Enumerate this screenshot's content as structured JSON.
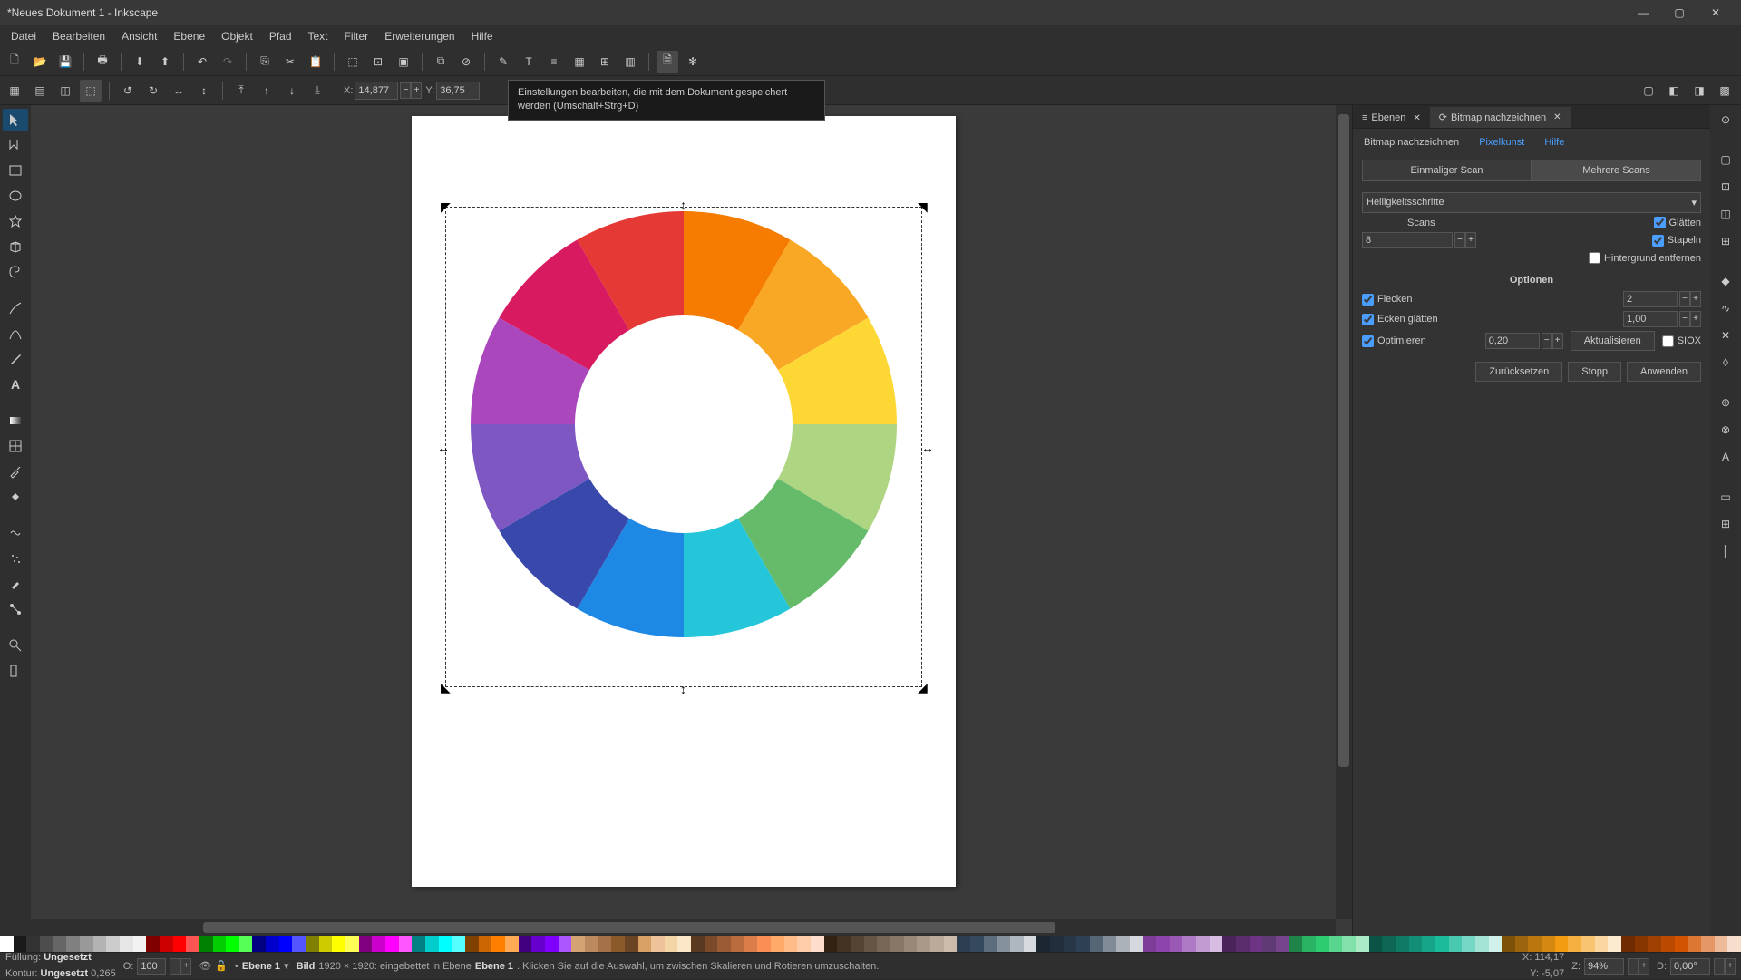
{
  "title": "*Neues Dokument 1 - Inkscape",
  "menu": [
    "Datei",
    "Bearbeiten",
    "Ansicht",
    "Ebene",
    "Objekt",
    "Pfad",
    "Text",
    "Filter",
    "Erweiterungen",
    "Hilfe"
  ],
  "tooltip": "Einstellungen bearbeiten, die mit dem Dokument gespeichert werden (Umschalt+Strg+D)",
  "coords": {
    "xlabel": "X:",
    "xval": "14,877",
    "ylabel": "Y:",
    "yval": "36,75"
  },
  "panel": {
    "tab_layers": "Ebenen",
    "tab_trace": "Bitmap nachzeichnen",
    "sub_trace": "Bitmap nachzeichnen",
    "sub_pixel": "Pixelkunst",
    "sub_help": "Hilfe",
    "scan_single": "Einmaliger Scan",
    "scan_multi": "Mehrere Scans",
    "mode": "Helligkeitsschritte",
    "scans_lbl": "Scans",
    "scans_val": "8",
    "smooth": "Glätten",
    "stack": "Stapeln",
    "removebg": "Hintergrund entfernen",
    "options": "Optionen",
    "speckles": "Flecken",
    "speckles_val": "2",
    "corners": "Ecken glätten",
    "corners_val": "1,00",
    "optimize": "Optimieren",
    "optimize_val": "0,20",
    "update": "Aktualisieren",
    "siox": "SIOX",
    "reset": "Zurücksetzen",
    "stop": "Stopp",
    "apply": "Anwenden"
  },
  "status": {
    "fill_lbl": "Füllung:",
    "fill_val": "Ungesetzt",
    "stroke_lbl": "Kontur:",
    "stroke_val": "Ungesetzt",
    "stroke_w": "0,265",
    "opacity_lbl": "O:",
    "opacity_val": "100",
    "layer": "Ebene 1",
    "info_pre": "Bild",
    "info_dim": "1920 × 1920: eingebettet in Ebene ",
    "info_layer": "Ebene 1",
    "info_post": ". Klicken Sie auf die Auswahl, um zwischen Skalieren und Rotieren umzuschalten.",
    "x": "X:",
    "xv": "114,17",
    "y": "Y:",
    "yv": "-5,07",
    "z": "Z:",
    "zv": "94%",
    "d": "D:",
    "dv": "0,00°"
  },
  "palette": [
    "#ffffff",
    "#1a1a1a",
    "#333333",
    "#4d4d4d",
    "#666666",
    "#808080",
    "#999999",
    "#b3b3b3",
    "#cccccc",
    "#e6e6e6",
    "#f2f2f2",
    "#800000",
    "#cc0000",
    "#ff0000",
    "#ff5555",
    "#008000",
    "#00cc00",
    "#00ff00",
    "#55ff55",
    "#000080",
    "#0000cc",
    "#0000ff",
    "#5555ff",
    "#808000",
    "#cccc00",
    "#ffff00",
    "#ffff55",
    "#800080",
    "#cc00cc",
    "#ff00ff",
    "#ff55ff",
    "#008080",
    "#00cccc",
    "#00ffff",
    "#55ffff",
    "#804000",
    "#cc6600",
    "#ff8000",
    "#ffaa55",
    "#400080",
    "#6600cc",
    "#8000ff",
    "#aa55ff",
    "#d4a373",
    "#bc8a5f",
    "#a47148",
    "#8b5a2b",
    "#6b4423",
    "#d9a066",
    "#eec39a",
    "#f4d5a6",
    "#fae8c8",
    "#5a3921",
    "#7a4a2b",
    "#9a5b35",
    "#ba6c3f",
    "#da7d49",
    "#fa8e53",
    "#ffaa66",
    "#ffbb88",
    "#ffccaa",
    "#ffddcc",
    "#332211",
    "#443322",
    "#554433",
    "#665544",
    "#776655",
    "#887766",
    "#998877",
    "#aa9988",
    "#bbaa99",
    "#ccbbaa",
    "#2c3e50",
    "#34495e",
    "#5d6d7e",
    "#85929e",
    "#aeb6bf",
    "#d6dbdf",
    "#1b2631",
    "#212f3c",
    "#283747",
    "#2e4053",
    "#566573",
    "#808b96",
    "#abb2b9",
    "#d5d8dc",
    "#7d3c98",
    "#8e44ad",
    "#9b59b6",
    "#af7ac5",
    "#c39bd3",
    "#d7bde2",
    "#4a235a",
    "#5b2c6c",
    "#6c3483",
    "#603a75",
    "#76448a",
    "#1e8449",
    "#28b463",
    "#2ecc71",
    "#58d68d",
    "#82e0aa",
    "#abebc6",
    "#0b5345",
    "#0e6655",
    "#117a65",
    "#148f77",
    "#17a589",
    "#1abc9c",
    "#48c9b0",
    "#76d7c4",
    "#a3e4d7",
    "#d1f2eb",
    "#7e5109",
    "#9c640c",
    "#b9770e",
    "#d68910",
    "#f39c12",
    "#f5b041",
    "#f8c471",
    "#fad7a0",
    "#fdebd0",
    "#6e2c00",
    "#873600",
    "#a04000",
    "#ba4a00",
    "#d35400",
    "#dc7633",
    "#e59866",
    "#edbb99",
    "#f6ddcc"
  ],
  "chart_data": {
    "type": "pie",
    "title": "Color wheel image (12 equal donut segments)",
    "categories": [
      "orange",
      "amber",
      "yellow",
      "yellow-green",
      "green",
      "cyan",
      "blue",
      "indigo",
      "violet",
      "magenta",
      "crimson",
      "red-orange"
    ],
    "values": [
      1,
      1,
      1,
      1,
      1,
      1,
      1,
      1,
      1,
      1,
      1,
      1
    ],
    "colors": [
      "#f57c00",
      "#f9a825",
      "#fdd835",
      "#aed581",
      "#66bb6a",
      "#26c6da",
      "#1e88e5",
      "#3949ab",
      "#7e57c2",
      "#ab47bc",
      "#d81b60",
      "#e53935"
    ]
  }
}
